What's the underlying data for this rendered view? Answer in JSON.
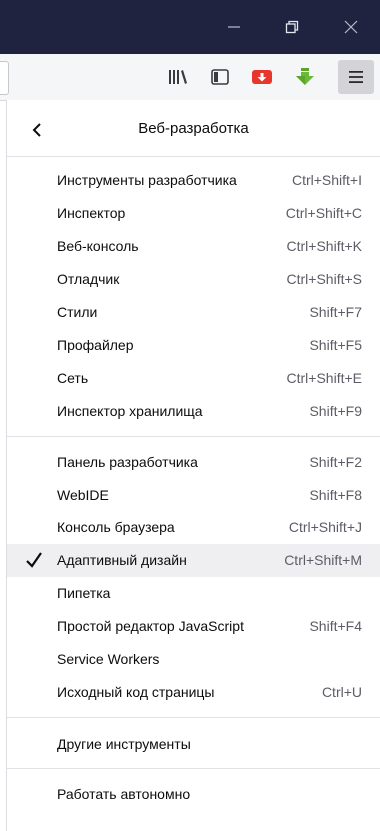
{
  "window": {
    "minimize_glyph": "—",
    "maximize_icon": "restore-icon",
    "close_glyph": "✕"
  },
  "toolbar": {
    "icons": [
      "library-icon",
      "sidebar-icon",
      "save-to-pocket-icon",
      "download-icon",
      "hamburger-menu-icon"
    ]
  },
  "panel": {
    "title": "Веб-разработка",
    "sections": [
      {
        "items": [
          {
            "label": "Инструменты разработчика",
            "shortcut": "Ctrl+Shift+I"
          },
          {
            "label": "Инспектор",
            "shortcut": "Ctrl+Shift+C"
          },
          {
            "label": "Веб-консоль",
            "shortcut": "Ctrl+Shift+K"
          },
          {
            "label": "Отладчик",
            "shortcut": "Ctrl+Shift+S"
          },
          {
            "label": "Стили",
            "shortcut": "Shift+F7"
          },
          {
            "label": "Профайлер",
            "shortcut": "Shift+F5"
          },
          {
            "label": "Сеть",
            "shortcut": "Ctrl+Shift+E"
          },
          {
            "label": "Инспектор хранилища",
            "shortcut": "Shift+F9"
          }
        ]
      },
      {
        "items": [
          {
            "label": "Панель разработчика",
            "shortcut": "Shift+F2"
          },
          {
            "label": "WebIDE",
            "shortcut": "Shift+F8"
          },
          {
            "label": "Консоль браузера",
            "shortcut": "Ctrl+Shift+J"
          },
          {
            "label": "Адаптивный дизайн",
            "shortcut": "Ctrl+Shift+M",
            "checked": true
          },
          {
            "label": "Пипетка",
            "shortcut": ""
          },
          {
            "label": "Простой редактор JavaScript",
            "shortcut": "Shift+F4"
          },
          {
            "label": "Service Workers",
            "shortcut": ""
          },
          {
            "label": "Исходный код страницы",
            "shortcut": "Ctrl+U"
          }
        ]
      },
      {
        "items": [
          {
            "label": "Другие инструменты",
            "shortcut": ""
          }
        ]
      },
      {
        "items": [
          {
            "label": "Работать автономно",
            "shortcut": ""
          }
        ]
      }
    ]
  }
}
